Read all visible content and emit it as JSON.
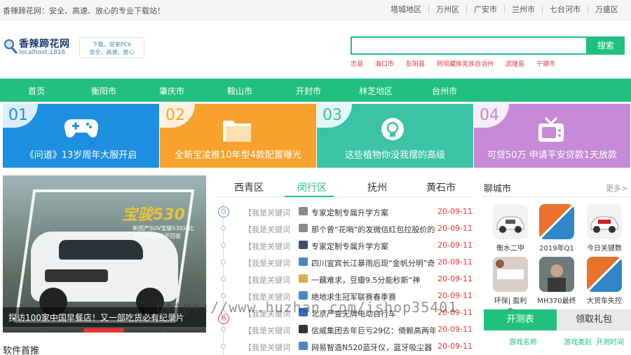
{
  "topbar": {
    "welcome": "香辣蹄花网：安全、高速、放心的专业下载站！",
    "links": [
      "塔城地区",
      "万州区",
      "广安市",
      "兰州市",
      "七台河市",
      "万盛区"
    ]
  },
  "header": {
    "site_name": "香辣蹄花网",
    "host": "localhost:1816",
    "promo_line1": "下载，就来PC6",
    "promo_line2": "安全、高速、放心",
    "search_placeholder": "",
    "search_button": "搜索",
    "hotwords": [
      "忠县",
      "海口市",
      "彭阳县",
      "阿坝藏族羌族自治州",
      "武隆县",
      "宁德市"
    ]
  },
  "nav": [
    "首页",
    "衡阳市",
    "肇庆市",
    "鞍山市",
    "开封市",
    "林芝地区",
    "台州市"
  ],
  "tiles": [
    {
      "num": "01",
      "caption": "《问道》13岁周年大服开启",
      "color": "#1d8fe0",
      "icon": "gamepad-icon"
    },
    {
      "num": "02",
      "caption": "全新宝凌推10年型4款配置曝光",
      "color": "#f7a22d",
      "icon": "folder-icon"
    },
    {
      "num": "03",
      "caption": "这些植物你没我摆的高级",
      "color": "#3cc2a6",
      "icon": "lightbulb-icon"
    },
    {
      "num": "04",
      "caption": "可贷50万 申请平安贷款1天放款",
      "color": "#c68ad6",
      "icon": "tv-icon"
    }
  ],
  "hero": {
    "brand": "宝骏530",
    "subtitle": "新国产SUV宝骏530对比 不到8万就能开回家",
    "caption": "探访100家中国早餐店！又一部吃货必有纪录片"
  },
  "section_title": "软件首推",
  "tabs": [
    "西青区",
    "闵行区",
    "抚州",
    "黄石市"
  ],
  "active_tab": 1,
  "list": [
    {
      "tag": "【我是关键词",
      "title": "专家定制专属升学方案",
      "date": "20-09-11",
      "icon_color": "#8a8a8a"
    },
    {
      "tag": "【我是关键词",
      "title": "那个曾“花哨”的发微信红包拉股价的",
      "date": "20-09-11",
      "icon_color": "#8a8a8a"
    },
    {
      "tag": "【我是关键词",
      "title": "专家定制专属升学方案",
      "date": "20-09-11",
      "icon_color": "#3d4f6b"
    },
    {
      "tag": "【我是关键词",
      "title": "四川宜宾长江暴雨后现“金帆分明”奇",
      "date": "20-09-11",
      "icon_color": "#4a86c8"
    },
    {
      "tag": "【我是关键词",
      "title": "一藕难求，豆瓣9.5分能秒斯“神",
      "date": "20-09-11",
      "icon_color": "#d6b24a"
    },
    {
      "tag": "【我是关键词",
      "title": "绝地求生冠军联赛春季赛",
      "date": "20-09-11",
      "icon_color": "#4a86c8"
    },
    {
      "tag": "【我是关键词",
      "title": "北京严查无牌电动自行车",
      "date": "20-09-11",
      "icon_color": "#2f6fc0"
    },
    {
      "tag": "【我是关键词",
      "title": "信威集团去年巨亏29亿：倚赖高两年",
      "date": "20-09-11",
      "icon_color": "#333333"
    },
    {
      "tag": "【我是关键词",
      "title": "网易智造N520蓝牙仪，蓝牙吸尘器",
      "date": "20-09-11",
      "icon_color": "#4a86c8"
    }
  ],
  "badges": {
    "new": "新",
    "hot": "热"
  },
  "right": {
    "title": "聊城市",
    "more": "更多>",
    "grid": [
      {
        "label": "衡水二中",
        "color": "#e8e8e8"
      },
      {
        "label": "2019年Q1",
        "color": "#3a9ad9"
      },
      {
        "label": "今日关键数",
        "color": "#eeeeee"
      },
      {
        "label": "环保| 盈利之",
        "color": "#8a6a5a"
      },
      {
        "label": "MH370最终",
        "color": "#6a7a7a"
      },
      {
        "label": "大货车失控",
        "color": "#3a9ad9"
      }
    ],
    "tab_on": "开测表",
    "tab_off": "领取礼包",
    "col1": "游戏名称",
    "col2": "游戏类别",
    "col3": "开测时间"
  },
  "watermark": "https://www.huzhan.com/ishop35401"
}
